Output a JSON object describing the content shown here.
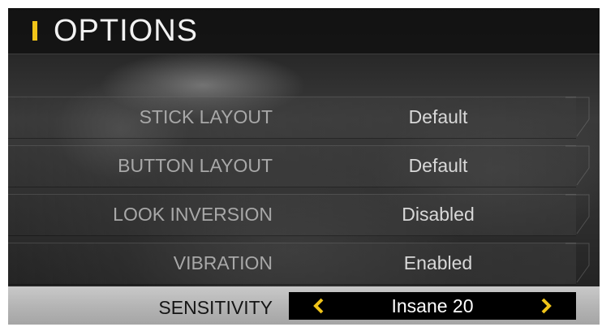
{
  "screen": {
    "title": "OPTIONS"
  },
  "options": [
    {
      "label": "STICK LAYOUT",
      "value": "Default"
    },
    {
      "label": "BUTTON LAYOUT",
      "value": "Default"
    },
    {
      "label": "LOOK INVERSION",
      "value": "Disabled"
    },
    {
      "label": "VIBRATION",
      "value": "Enabled"
    }
  ],
  "selected_option": {
    "label": "SENSITIVITY",
    "value": "Insane 20",
    "prev_arrow_icon": "chevron-left-icon",
    "next_arrow_icon": "chevron-right-icon"
  },
  "colors": {
    "accent": "#f0c419",
    "selected_row": "#b4b4b4",
    "value_box": "#000000",
    "label_text": "#a8a8a8",
    "value_text": "#d8d8d8"
  }
}
